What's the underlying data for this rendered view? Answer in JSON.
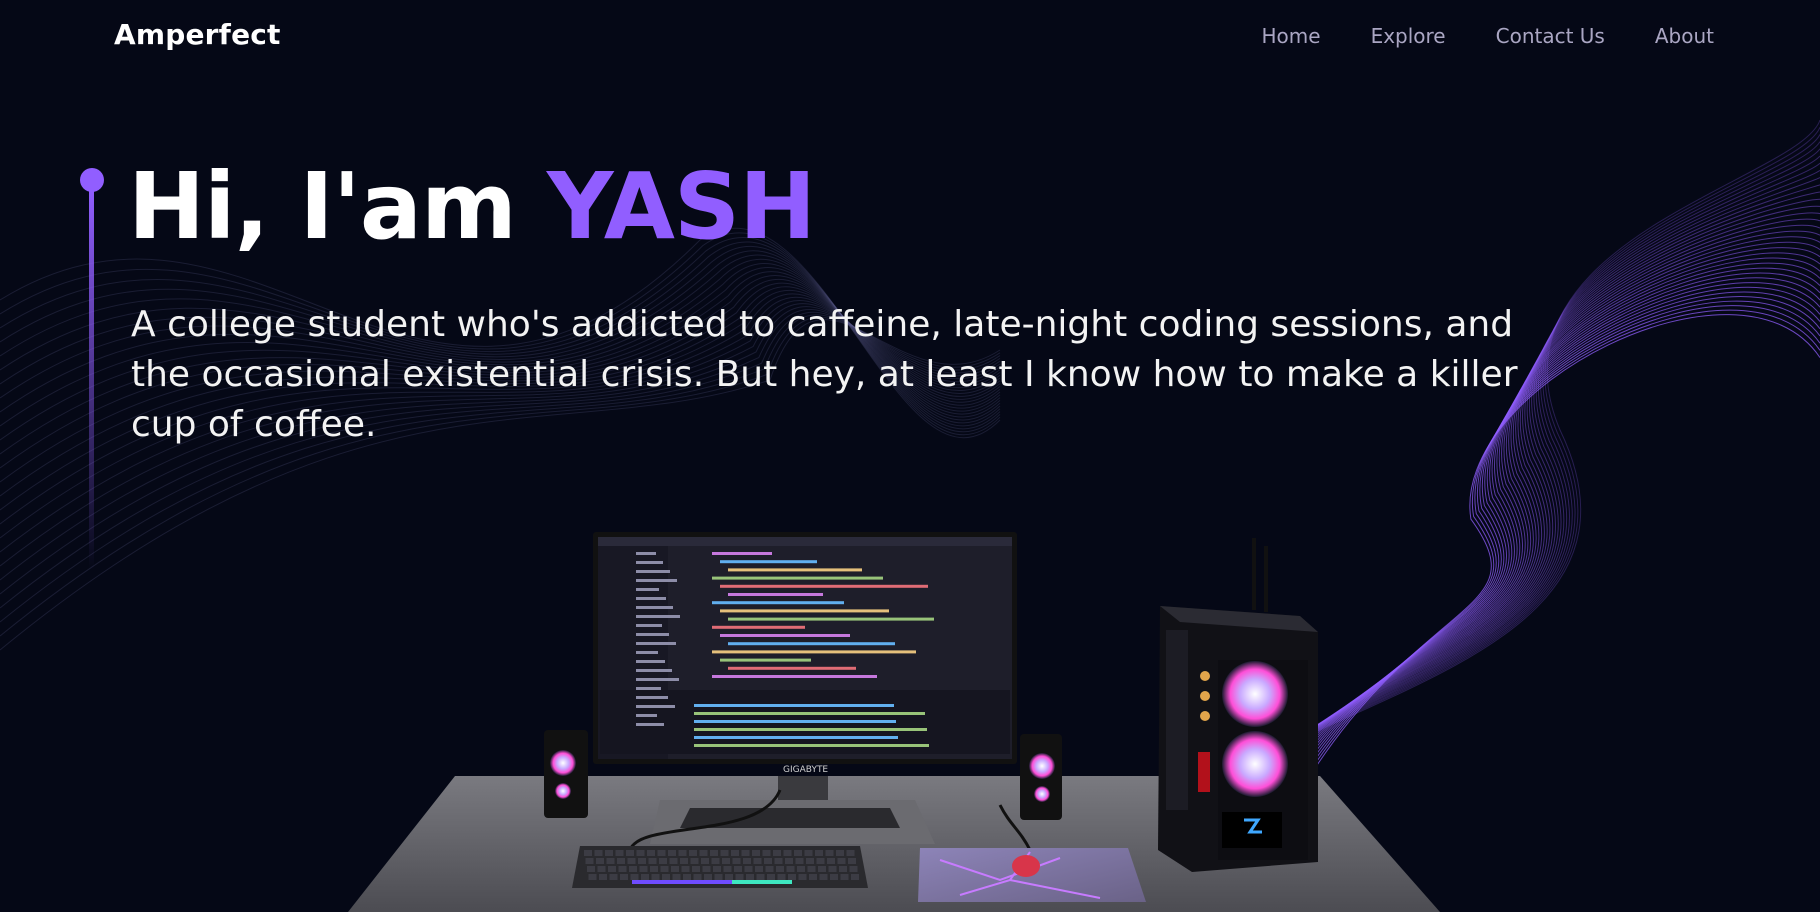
{
  "brand": {
    "logo_text": "Amperfect"
  },
  "nav": {
    "items": [
      {
        "label": "Home"
      },
      {
        "label": "Explore"
      },
      {
        "label": "Contact Us"
      },
      {
        "label": "About"
      }
    ]
  },
  "hero": {
    "greeting": "Hi, I'am ",
    "name": "YASH",
    "subtitle": "A college student who's addicted to caffeine, late-night coding sessions, and the occasional existential crisis. But hey, at least I know how to make a killer cup of coffee."
  },
  "scene": {
    "monitor_brand": "GIGABYTE"
  },
  "colors": {
    "background": "#050816",
    "accent": "#915eff",
    "nav_text": "#aaa6c3",
    "text": "#ffffff"
  }
}
